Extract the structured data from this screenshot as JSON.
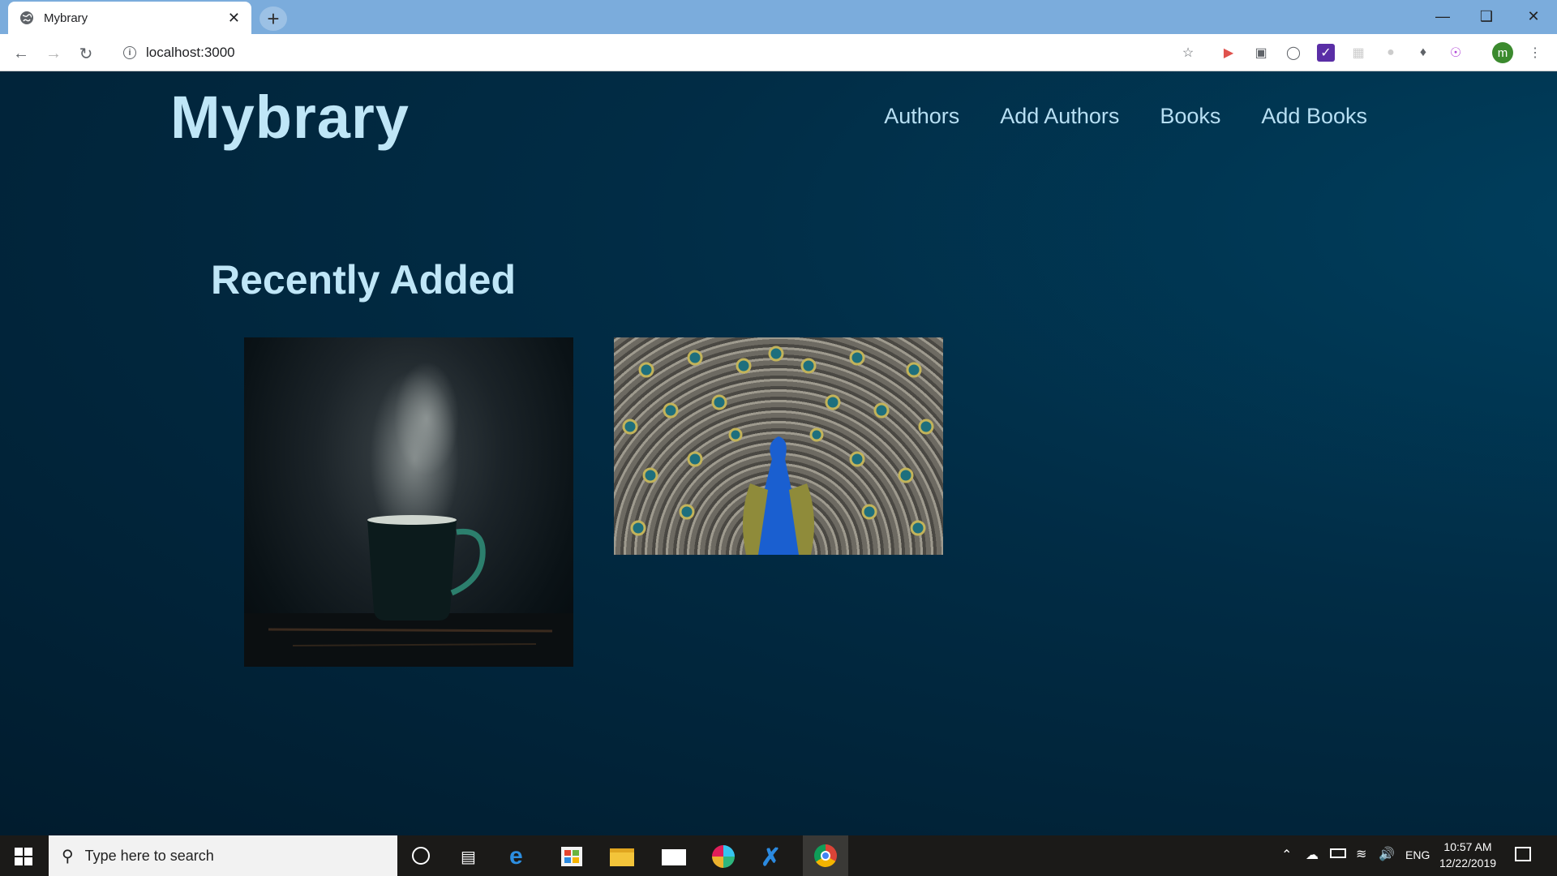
{
  "browser": {
    "tab_title": "Mybrary",
    "url": "localhost:3000",
    "profile_initial": "m"
  },
  "site": {
    "brand": "Mybrary",
    "nav": [
      "Authors",
      "Add Authors",
      "Books",
      "Add Books"
    ],
    "section_heading": "Recently Added"
  },
  "books": [
    {
      "cover_description": "steaming-mug"
    },
    {
      "cover_description": "peacock"
    }
  ],
  "taskbar": {
    "search_placeholder": "Type here to search",
    "language": "ENG",
    "time": "10:57 AM",
    "date": "12/22/2019"
  },
  "colors": {
    "brand": "#bfe6f7",
    "page_bg": "#011c2e",
    "tabstrip": "#7bacdc",
    "taskbar": "#1b1a18"
  }
}
